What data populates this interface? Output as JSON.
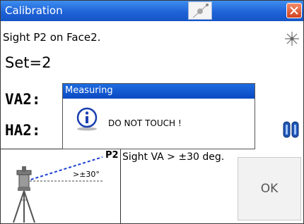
{
  "window": {
    "title": "Calibration"
  },
  "main": {
    "instruction": "Sight P2 on Face2.",
    "set_label": "Set=2",
    "va_label": "VA2:",
    "ha_label": "HA2:"
  },
  "panel": {
    "point_label": "P2",
    "angle_label": ">±30°",
    "sight_text": "Sight VA > ±30 deg.",
    "ok_label": "OK"
  },
  "dialog": {
    "title": "Measuring",
    "message": "DO NOT TOUCH !"
  },
  "icons": {
    "title_center": "laser-plumb-icon",
    "close": "close-icon",
    "top_right": "star-laser-icon",
    "right": "battery-icon",
    "dialog": "info-icon",
    "panel": "instrument-tripod-icon"
  },
  "colors": {
    "titlebar": "#1f63d8",
    "close": "#d2421e",
    "dialog_title": "#0a49c2",
    "sight_line": "#1a3fd6"
  }
}
